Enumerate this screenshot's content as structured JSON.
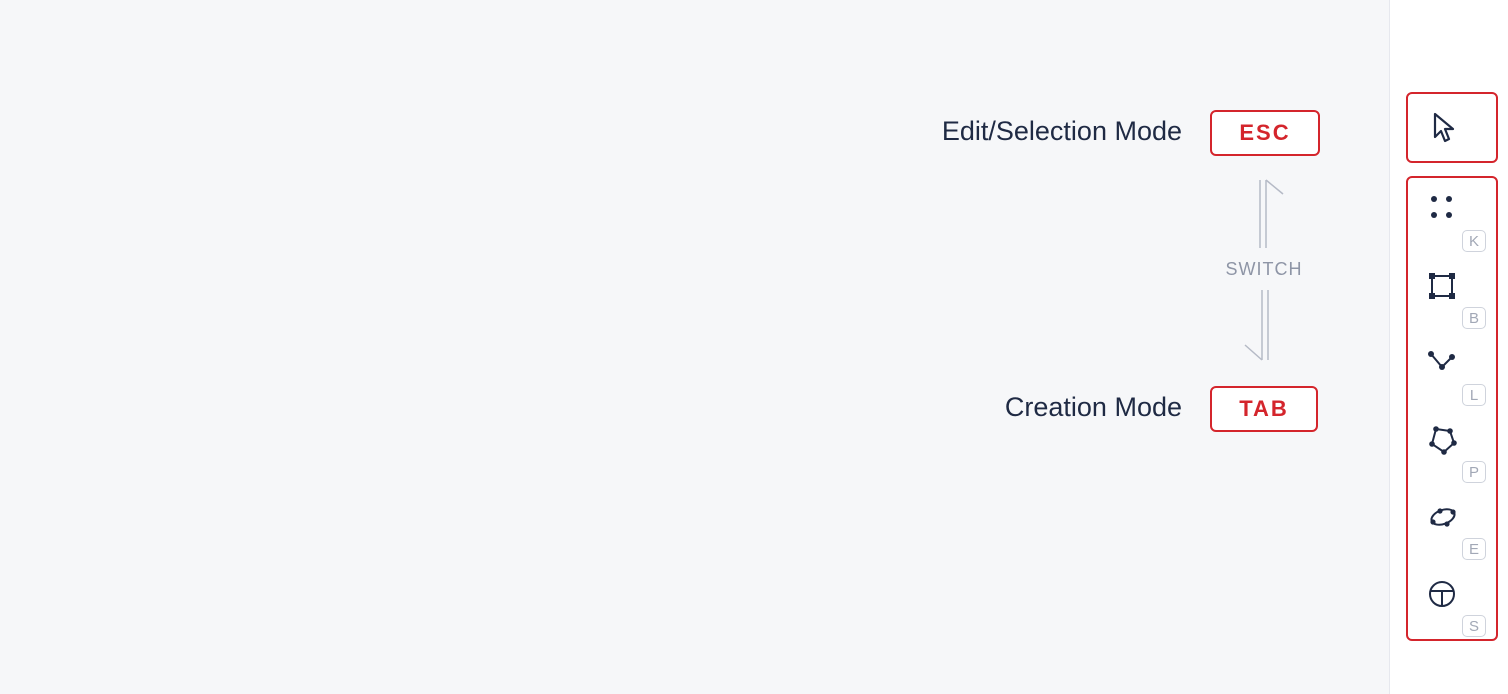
{
  "modes": {
    "edit": {
      "label": "Edit/Selection Mode",
      "key": "ESC"
    },
    "creation": {
      "label": "Creation Mode",
      "key": "TAB"
    },
    "switch_label": "SWITCH"
  },
  "toolbar": {
    "select_tool": {
      "icon": "cursor-icon"
    },
    "tools": [
      {
        "name": "keypoints",
        "icon": "keypoints-icon",
        "hotkey": "K"
      },
      {
        "name": "bounding-box",
        "icon": "bounding-box-icon",
        "hotkey": "B"
      },
      {
        "name": "polyline",
        "icon": "polyline-icon",
        "hotkey": "L"
      },
      {
        "name": "polygon",
        "icon": "polygon-icon",
        "hotkey": "P"
      },
      {
        "name": "ellipse",
        "icon": "ellipse-icon",
        "hotkey": "E"
      },
      {
        "name": "segmentation",
        "icon": "segmentation-icon",
        "hotkey": "S"
      }
    ]
  },
  "colors": {
    "accent": "#d4252c",
    "text_dark": "#1f2a44",
    "muted": "#8e95a6",
    "canvas_bg": "#f6f7f9"
  }
}
